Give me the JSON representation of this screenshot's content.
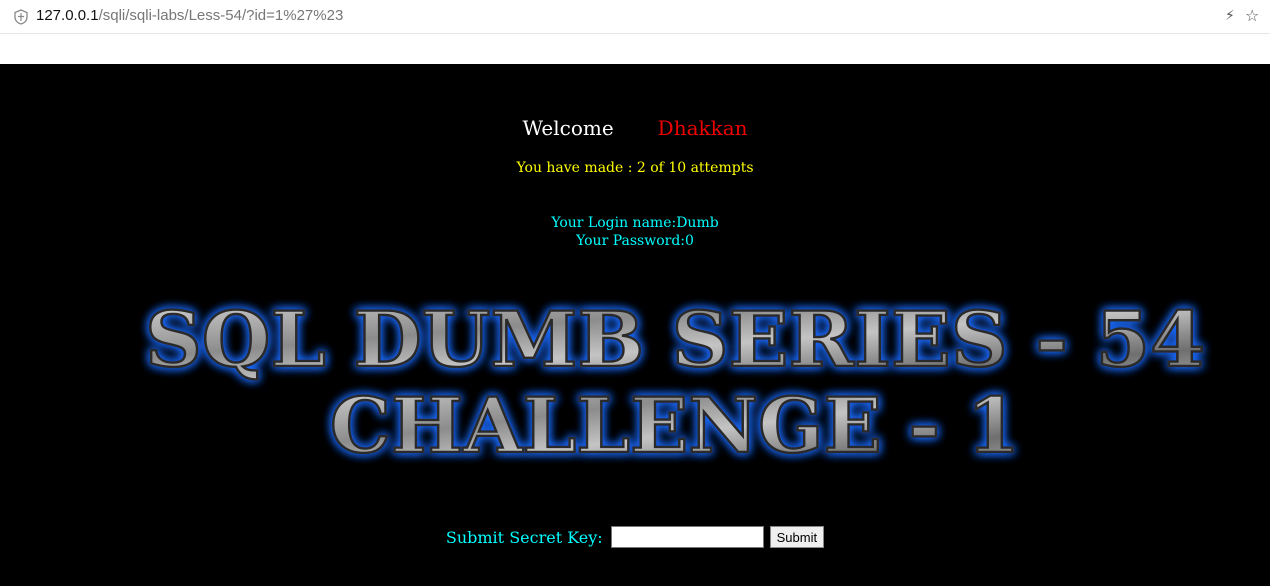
{
  "browser": {
    "url_host": "127.0.0.1",
    "url_path": "/sqli/sqli-labs/Less-54/?id=1%27%23",
    "icons": [
      "shield-icon",
      "bolt-icon",
      "star-icon"
    ]
  },
  "page": {
    "welcome": "Welcome",
    "name": "Dhakkan",
    "attempts": "You have made : 2 of 10 attempts",
    "login_name": "Your Login name:Dumb",
    "password": "Your Password:0",
    "banner_line1": "SQL DUMB SERIES - 54",
    "banner_line2": "CHALLENGE - 1",
    "form_label": "Submit Secret Key:",
    "input_value": "",
    "submit_label": "Submit"
  },
  "colors": {
    "background": "#000000",
    "welcome": "#ffffff",
    "name": "#ee0000",
    "attempts": "#ffff00",
    "login": "#00ffff",
    "banner_glow": "#1e6bff"
  }
}
